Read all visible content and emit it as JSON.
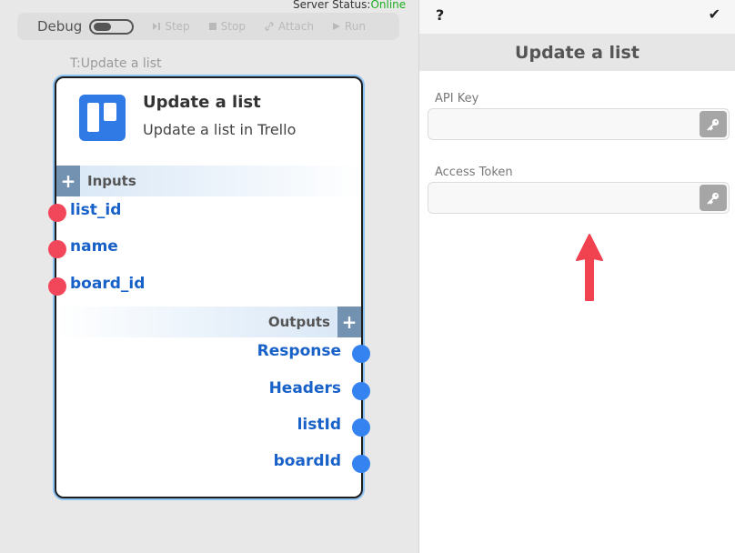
{
  "server_status": {
    "label": "Server Status:",
    "value": "Online",
    "color": "#1cae1c"
  },
  "toolbar": {
    "debug_label": "Debug",
    "debug_on": false,
    "step_label": "Step",
    "stop_label": "Stop",
    "attach_label": "Attach",
    "run_label": "Run"
  },
  "node": {
    "caption": "T:Update a list",
    "icon": "trello-icon",
    "title": "Update a list",
    "subtitle": "Update a list in Trello",
    "inputs_label": "Inputs",
    "outputs_label": "Outputs",
    "inputs": [
      "list_id",
      "name",
      "board_id"
    ],
    "outputs": [
      "Response",
      "Headers",
      "listId",
      "boardId"
    ],
    "input_port_color": "#f2475a",
    "output_port_color": "#3583f0"
  },
  "panel": {
    "help_label": "?",
    "confirm_label": "✔",
    "title": "Update a list",
    "fields": [
      {
        "label": "API Key",
        "value": "",
        "icon": "key-icon"
      },
      {
        "label": "Access Token",
        "value": "",
        "icon": "key-icon"
      }
    ],
    "annotation_arrow_color": "#f0424f"
  }
}
